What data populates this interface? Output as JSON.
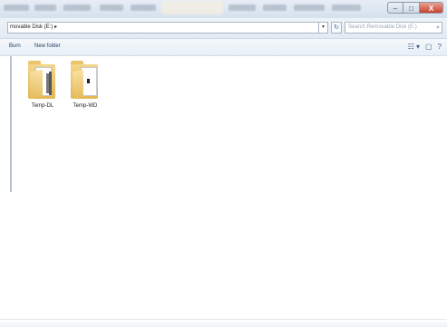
{
  "window": {
    "caption_buttons": {
      "minimize": "–",
      "maximize": "□",
      "close": "X"
    }
  },
  "address_bar": {
    "path": "movable Disk (E:) ▸",
    "dropdown": "▾",
    "refresh": "↻"
  },
  "search": {
    "placeholder": "Search Removable Disk (E:)",
    "icon": "search-icon"
  },
  "toolbar": {
    "items": [
      "Burn",
      "New folder"
    ],
    "icons": [
      "view-options-icon",
      "preview-pane-icon",
      "help-icon"
    ],
    "icon_glyphs": [
      "☷ ▾",
      "▢",
      "?"
    ]
  },
  "files": [
    {
      "name": "Temp-DL",
      "icon": "folder-icon"
    },
    {
      "name": "Temp-WD",
      "icon": "folder-icon"
    }
  ],
  "colors": {
    "title_bar": "#dfe7f1",
    "close_button": "#c8442e",
    "folder": "#e6bd5e"
  }
}
